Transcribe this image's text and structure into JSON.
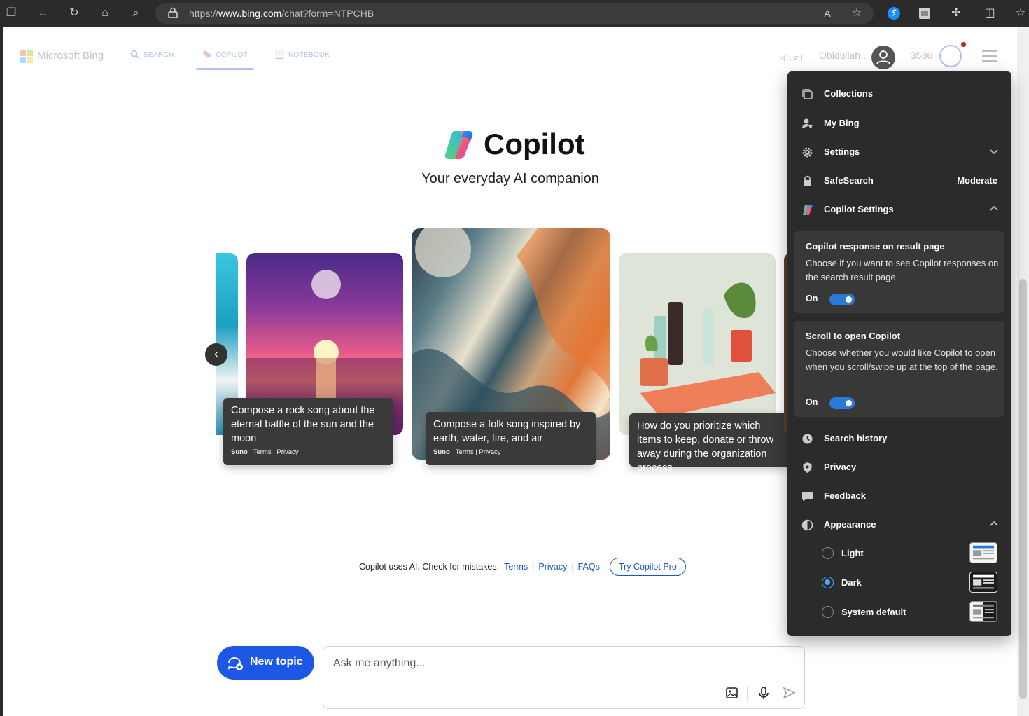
{
  "browser": {
    "url_prefix": "https://",
    "url_host": "www.bing.com",
    "url_path": "/chat?form=NTPCHB"
  },
  "header": {
    "brand": "Microsoft Bing",
    "tabs": [
      {
        "label": "SEARCH"
      },
      {
        "label": "COPILOT"
      },
      {
        "label": "NOTEBOOK"
      }
    ],
    "language": "বাংলা",
    "user_name": "Obidullah...",
    "points": "3586"
  },
  "hero": {
    "title": "Copilot",
    "subtitle": "Your everyday AI companion"
  },
  "cards": [
    {
      "text": "Compose a rock song about the eternal battle of the sun and the moon",
      "source": "Suno",
      "links": "Terms | Privacy"
    },
    {
      "text": "Compose a folk song inspired by earth, water, fire, and air",
      "source": "Suno",
      "links": "Terms | Privacy"
    },
    {
      "text": "How do you prioritize which items to keep, donate or throw away during the organization process"
    }
  ],
  "footer": {
    "disclaimer": "Copilot uses AI. Check for mistakes.",
    "terms": "Terms",
    "privacy": "Privacy",
    "faqs": "FAQs",
    "try_pro": "Try Copilot Pro"
  },
  "composer": {
    "new_topic": "New topic",
    "placeholder": "Ask me anything..."
  },
  "menu": {
    "collections": "Collections",
    "my_bing": "My Bing",
    "settings": "Settings",
    "safesearch": "SafeSearch",
    "safesearch_value": "Moderate",
    "copilot_settings": "Copilot Settings",
    "response_title": "Copilot response on result page",
    "response_desc": "Choose if you want to see Copilot responses on the search result page.",
    "response_state": "On",
    "scroll_title": "Scroll to open Copilot",
    "scroll_desc": "Choose whether you would like Copilot to open when you scroll/swipe up at the top of the page.",
    "scroll_state": "On",
    "search_history": "Search history",
    "privacy": "Privacy",
    "feedback": "Feedback",
    "appearance": "Appearance",
    "appearance_options": [
      {
        "label": "Light"
      },
      {
        "label": "Dark"
      },
      {
        "label": "System default"
      }
    ]
  },
  "colors": {
    "accent": "#1c57e6",
    "panel_bg": "#2b2b2b",
    "toggle_on": "#2a7ad8"
  }
}
